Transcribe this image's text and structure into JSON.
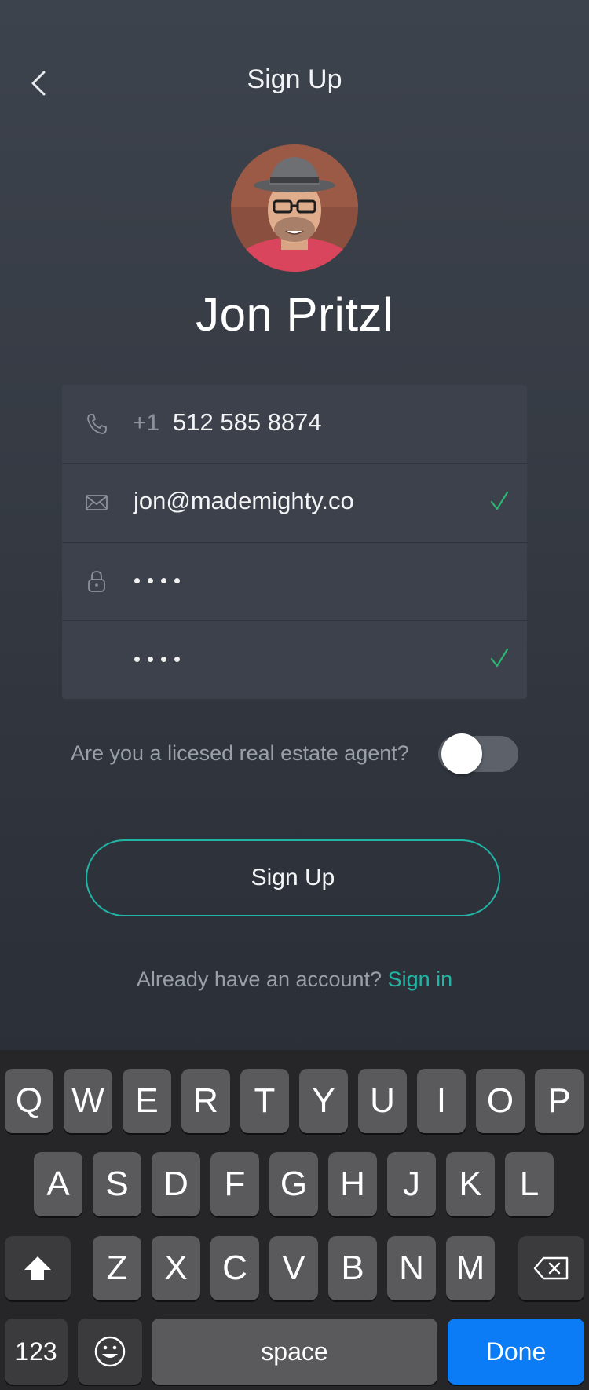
{
  "header": {
    "title": "Sign Up",
    "back_icon": "chevron-left-icon"
  },
  "profile": {
    "name": "Jon Pritzl",
    "avatar": "profile-photo"
  },
  "form": {
    "phone": {
      "icon": "phone-icon",
      "country_code": "+1",
      "value": "512 585 8874"
    },
    "email": {
      "icon": "mail-icon",
      "value": "jon@mademighty.co",
      "valid": true,
      "check_icon": "checkmark-icon"
    },
    "password": {
      "icon": "lock-icon",
      "masked_length": 4
    },
    "confirm_password": {
      "masked_length": 4,
      "valid": true,
      "check_icon": "checkmark-icon"
    }
  },
  "agent_question": {
    "label": "Are you a licesed real estate agent?",
    "toggle_on": false
  },
  "signup_button": {
    "label": "Sign Up"
  },
  "signin": {
    "prompt": "Already have an account?",
    "link": "Sign in"
  },
  "keyboard": {
    "row1": [
      "Q",
      "W",
      "E",
      "R",
      "T",
      "Y",
      "U",
      "I",
      "O",
      "P"
    ],
    "row2": [
      "A",
      "S",
      "D",
      "F",
      "G",
      "H",
      "J",
      "K",
      "L"
    ],
    "row3": [
      "Z",
      "X",
      "C",
      "V",
      "B",
      "N",
      "M"
    ],
    "numbers_label": "123",
    "space_label": "space",
    "done_label": "Done",
    "shift_icon": "shift-icon",
    "delete_icon": "backspace-icon",
    "emoji_icon": "emoji-icon"
  },
  "colors": {
    "accent": "#21b5a5",
    "check": "#2bb673",
    "done_key": "#0b7cf5"
  }
}
